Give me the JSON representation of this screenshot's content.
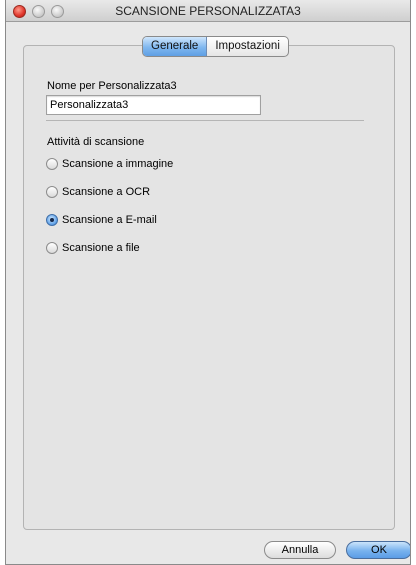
{
  "window": {
    "title": "SCANSIONE PERSONALIZZATA3"
  },
  "tabs": [
    {
      "label": "Generale",
      "selected": true
    },
    {
      "label": "Impostazioni",
      "selected": false
    }
  ],
  "name_field": {
    "label": "Nome per Personalizzata3",
    "value": "Personalizzata3"
  },
  "scan_activity": {
    "label": "Attività di scansione",
    "options": [
      {
        "label": "Scansione a immagine",
        "selected": false
      },
      {
        "label": "Scansione a OCR",
        "selected": false
      },
      {
        "label": "Scansione a E-mail",
        "selected": true
      },
      {
        "label": "Scansione a file",
        "selected": false
      }
    ]
  },
  "buttons": {
    "cancel": "Annulla",
    "ok": "OK"
  },
  "colors": {
    "accent": "#6aa8ea",
    "window_bg": "#e8e8e8",
    "close_button": "#e0352b"
  }
}
